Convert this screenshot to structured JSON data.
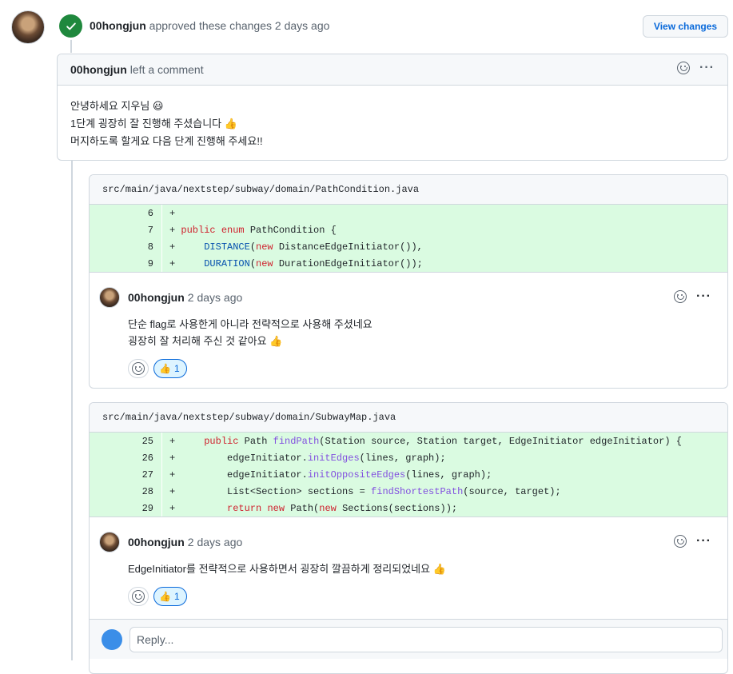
{
  "review": {
    "author": "00hongjun",
    "action_text": "approved these changes",
    "time": "2 days ago",
    "view_changes_label": "View changes"
  },
  "comment": {
    "author": "00hongjun",
    "action_text": "left a comment",
    "lines": [
      "안녕하세요 지우님 😃",
      "1단계 굉장히 잘 진행해 주셨습니다 👍",
      "머지하도록 할게요 다음 단계 진행해 주세요!!"
    ]
  },
  "files": [
    {
      "path": "src/main/java/nextstep/subway/domain/PathCondition.java",
      "lines": [
        {
          "num": "6",
          "code": "+"
        },
        {
          "num": "7",
          "code": "+ public enum PathCondition {"
        },
        {
          "num": "8",
          "code": "+     DISTANCE(new DistanceEdgeInitiator()),"
        },
        {
          "num": "9",
          "code": "+     DURATION(new DurationEdgeInitiator());"
        }
      ],
      "review_comment": {
        "author": "00hongjun",
        "time": "2 days ago",
        "lines": [
          "단순 flag로 사용한게 아니라 전략적으로 사용해 주셨네요",
          "굉장히 잘 처리해 주신 것 같아요 👍"
        ],
        "reaction_emoji": "👍",
        "reaction_count": "1"
      }
    },
    {
      "path": "src/main/java/nextstep/subway/domain/SubwayMap.java",
      "lines": [
        {
          "num": "25",
          "code": "+     public Path findPath(Station source, Station target, EdgeInitiator edgeInitiator) {"
        },
        {
          "num": "26",
          "code": "+         edgeInitiator.initEdges(lines, graph);"
        },
        {
          "num": "27",
          "code": "+         edgeInitiator.initOppositeEdges(lines, graph);"
        },
        {
          "num": "28",
          "code": "+         List<Section> sections = findShortestPath(source, target);"
        },
        {
          "num": "29",
          "code": "+         return new Path(new Sections(sections));"
        }
      ],
      "review_comment": {
        "author": "00hongjun",
        "time": "2 days ago",
        "lines": [
          "EdgeInitiator를 전략적으로 사용하면서 굉장히 깔끔하게 정리되었네요 👍"
        ],
        "reaction_emoji": "👍",
        "reaction_count": "1"
      }
    }
  ],
  "reply": {
    "placeholder": "Reply..."
  },
  "icons": {
    "approved": "check-circle-icon",
    "emoji": "smiley-icon",
    "more": "kebab-horizontal-icon"
  },
  "colors": {
    "approved_green": "#1f883d",
    "link_blue": "#0969da",
    "diff_added_bg": "#dafbe1"
  }
}
